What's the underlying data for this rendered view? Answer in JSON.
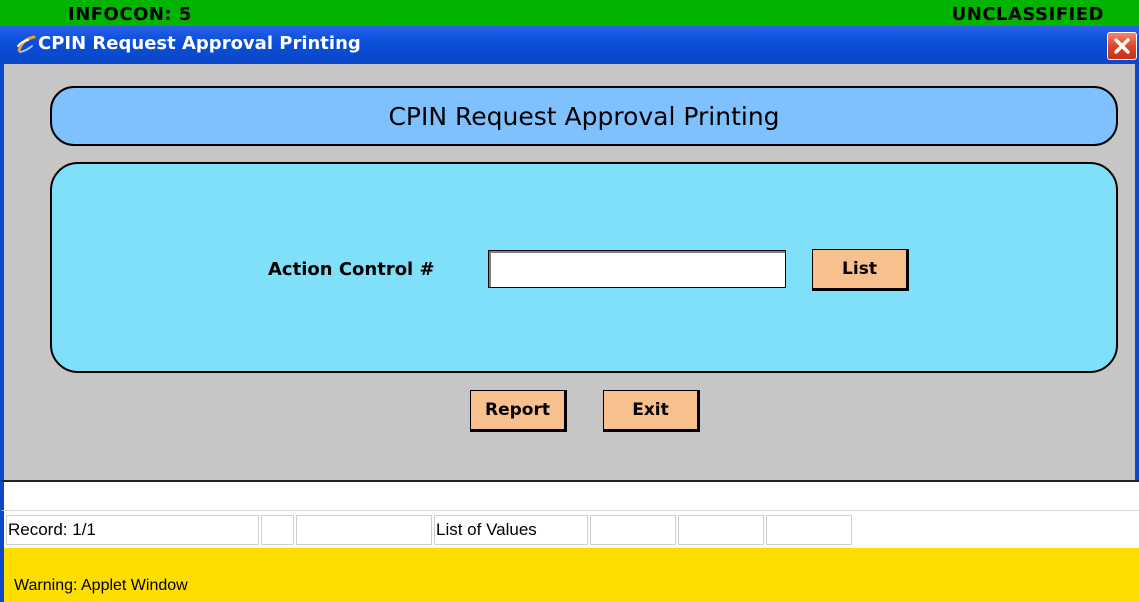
{
  "classification_bar": {
    "left_text": "INFOCON: 5",
    "right_text": "UNCLASSIFIED",
    "color": "#00b400"
  },
  "window": {
    "title": "CPIN Request Approval Printing",
    "icon": "java-cup-icon",
    "close_icon": "close-icon"
  },
  "header": {
    "title": "CPIN Request Approval Printing"
  },
  "form": {
    "action_control_label": "Action Control #",
    "action_control_value": "",
    "list_button": "List"
  },
  "actions": {
    "report_button": "Report",
    "exit_button": "Exit"
  },
  "status_bar": {
    "record": "Record: 1/1",
    "cell_2": "",
    "cell_3": "",
    "mode": "List of Values",
    "cell_5": "",
    "cell_6": "",
    "cell_7": ""
  },
  "warning": {
    "text": "Warning: Applet Window",
    "color": "#fede00"
  }
}
